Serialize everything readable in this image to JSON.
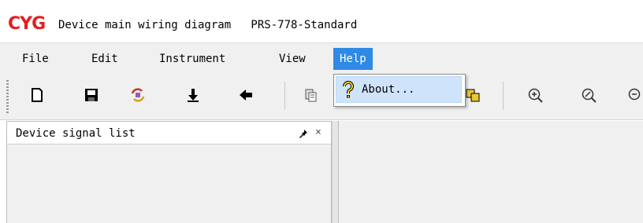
{
  "title_bar": {
    "logo": "CYG",
    "title": "Device main wiring diagram   PRS-778-Standard"
  },
  "menubar": {
    "items": [
      "File",
      "Edit",
      "Instrument",
      "View",
      "Help"
    ],
    "active": "Help"
  },
  "toolbar": {
    "buttons": [
      "new-file-icon",
      "save-icon",
      "refresh-icon",
      "download-icon",
      "back-icon",
      "copy-icon",
      "paste-icon",
      "zoom-in-icon",
      "zoom-out-icon",
      "zoom-fit-icon"
    ]
  },
  "help_menu": {
    "items": [
      {
        "label": "About...",
        "icon": "help-question-icon"
      }
    ]
  },
  "left_panel": {
    "title": "Device signal list",
    "pin_icon": "pin-icon",
    "close_glyph": "×"
  },
  "colors": {
    "logo": "#e41e1e",
    "menu_active": "#2e8ae6",
    "hover": "#cfe4fb"
  }
}
